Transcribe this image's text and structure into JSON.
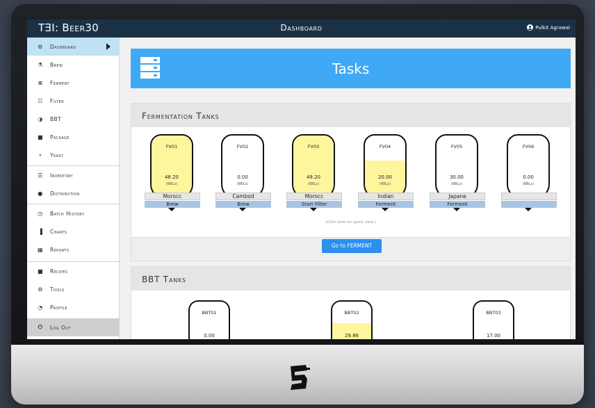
{
  "app": {
    "brand": "TƎI: Beer30",
    "page_title": "Dashboard",
    "user_name": "Pulkit Agrawal"
  },
  "sidebar": {
    "items": [
      {
        "label": "Dashboard",
        "icon": "tachometer-icon",
        "glyph": "⚙"
      },
      {
        "label": "Brew",
        "icon": "flask-icon",
        "glyph": "⚗"
      },
      {
        "label": "Ferment",
        "icon": "database-icon",
        "glyph": "≡"
      },
      {
        "label": "Filter",
        "icon": "th-icon",
        "glyph": "☷"
      },
      {
        "label": "BBT",
        "icon": "adjust-icon",
        "glyph": "◑"
      },
      {
        "label": "Package",
        "icon": "archive-icon",
        "glyph": "■"
      },
      {
        "label": "Yeast",
        "icon": "yeast-icon",
        "glyph": "⚬"
      },
      {
        "label": "Inventory",
        "icon": "list-icon",
        "glyph": "☰"
      },
      {
        "label": "Distribution",
        "icon": "globe-icon",
        "glyph": "●"
      },
      {
        "label": "Batch History",
        "icon": "clock-icon",
        "glyph": "◷"
      },
      {
        "label": "Charts",
        "icon": "bar-chart-icon",
        "glyph": "▐"
      },
      {
        "label": "Reports",
        "icon": "calculator-icon",
        "glyph": "▦"
      },
      {
        "label": "Recipes",
        "icon": "bookmark-icon",
        "glyph": "■"
      },
      {
        "label": "Tools",
        "icon": "cog-icon",
        "glyph": "⚙"
      },
      {
        "label": "Profile",
        "icon": "user-icon",
        "glyph": "◔"
      },
      {
        "label": "Log Out",
        "icon": "power-off-icon",
        "glyph": "⏻"
      }
    ]
  },
  "tasks": {
    "title": "Tasks"
  },
  "fermentation": {
    "title": "Fermentation Tanks",
    "hint": "(Click tank for quick view.)",
    "button_label": "Go to FERMENT",
    "unit": "(BBLs)",
    "tanks": [
      {
        "name": "FV01",
        "volume": "48.20",
        "beer": "Morocc",
        "stage": "Brew",
        "fill_fraction": 1.0
      },
      {
        "name": "FV02",
        "volume": "0.00",
        "beer": "Cambod",
        "stage": "Brew",
        "fill_fraction": 0.0
      },
      {
        "name": "FV03",
        "volume": "49.20",
        "beer": "Morocc",
        "stage": "Start Filter",
        "fill_fraction": 1.0
      },
      {
        "name": "FV04",
        "volume": "20.00",
        "beer": "Indian",
        "stage": "Ferment",
        "fill_fraction": 0.6
      },
      {
        "name": "FV05",
        "volume": "30.00",
        "beer": "Japane",
        "stage": "Ferment",
        "fill_fraction": 0.06
      },
      {
        "name": "FV06",
        "volume": "0.00",
        "beer": "",
        "stage": "",
        "fill_fraction": 0.0
      }
    ]
  },
  "bbt": {
    "title": "BBT Tanks",
    "tanks": [
      {
        "name": "BBT01",
        "volume": "0.00",
        "fill_fraction": 0.0
      },
      {
        "name": "BBT02",
        "volume": "29.86",
        "fill_fraction": 0.6
      },
      {
        "name": "BBT03",
        "volume": "17.00",
        "fill_fraction": 0.0
      }
    ]
  },
  "colors": {
    "topbar": "#1b3146",
    "tasks_banner": "#3fa9f5",
    "active_nav": "#bfe2f5",
    "tank_fill": "#fff59d",
    "stage_label": "#a8c4e4",
    "button": "#2d8ff0"
  }
}
